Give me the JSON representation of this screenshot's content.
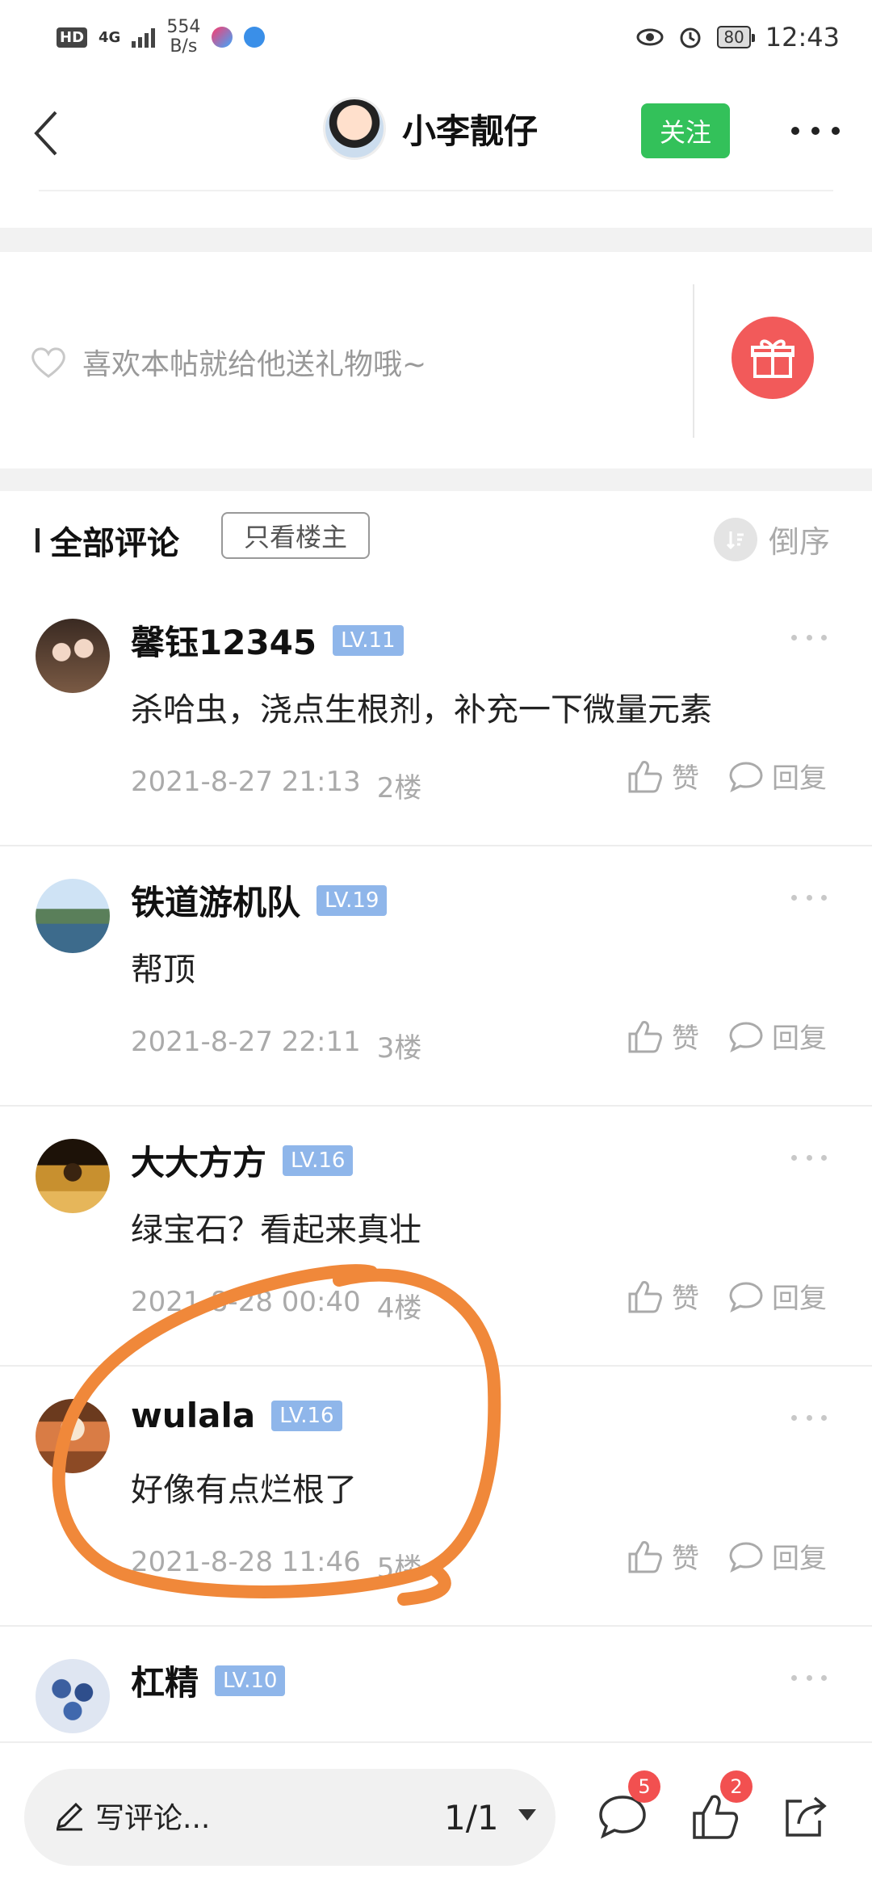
{
  "status_bar": {
    "hd_label": "HD",
    "network": "4G",
    "speed_value": "554",
    "speed_unit": "B/s",
    "battery": "80",
    "time": "12:43"
  },
  "header": {
    "author_name": "小李靓仔",
    "follow_label": "关注"
  },
  "gift": {
    "prompt": "喜欢本帖就给他送礼物哦~"
  },
  "comments_section": {
    "title": "全部评论",
    "only_op_label": "只看楼主",
    "sort_label": "倒序"
  },
  "comments": [
    {
      "name": "馨钰12345",
      "level": "LV.11",
      "text": "杀哈虫，浇点生根剂，补充一下微量元素",
      "time": "2021-8-27 21:13",
      "floor": "2楼",
      "like_label": "赞",
      "reply_label": "回复"
    },
    {
      "name": "铁道游机队",
      "level": "LV.19",
      "text": "帮顶",
      "time": "2021-8-27 22:11",
      "floor": "3楼",
      "like_label": "赞",
      "reply_label": "回复"
    },
    {
      "name": "大大方方",
      "level": "LV.16",
      "text": "绿宝石？看起来真壮",
      "time": "2021-8-28 00:40",
      "floor": "4楼",
      "like_label": "赞",
      "reply_label": "回复"
    },
    {
      "name": "wulala",
      "level": "LV.16",
      "text": "好像有点烂根了",
      "time": "2021-8-28 11:46",
      "floor": "5楼",
      "like_label": "赞",
      "reply_label": "回复"
    },
    {
      "name": "杠精",
      "level": "LV.10",
      "text": "",
      "time": "",
      "floor": "",
      "like_label": "",
      "reply_label": ""
    }
  ],
  "bottom_bar": {
    "write_label": "写评论...",
    "page_indicator": "1/1",
    "comment_count": "5",
    "like_count": "2"
  },
  "colors": {
    "follow_green": "#33c15a",
    "gift_red": "#f25a5a",
    "level_blue": "#8fb6ea",
    "annotation_orange": "#f0883a",
    "badge_red": "#f25050"
  },
  "icons": [
    "back-arrow-icon",
    "more-dots-icon",
    "heart-outline-icon",
    "gift-icon",
    "sort-icon",
    "thumbs-up-icon",
    "comment-bubble-icon",
    "pencil-icon",
    "share-icon"
  ]
}
